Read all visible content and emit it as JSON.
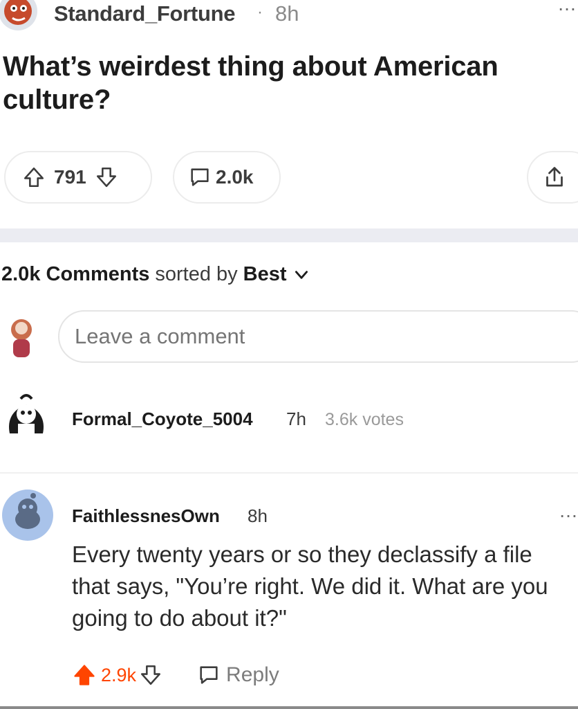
{
  "post": {
    "author": "Standard_Fortune",
    "time_separator": "·",
    "time": "8h",
    "more_icon": "…",
    "title": "What’s weirdest thing about American culture?",
    "upvotes": "791",
    "comments": "2.0k"
  },
  "comments_header": {
    "count": "2.0k Comments",
    "sorted_by": "sorted by",
    "sort": "Best"
  },
  "comment_input": {
    "placeholder": "Leave a comment"
  },
  "comments": [
    {
      "user": "Formal_Coyote_5004",
      "time": "7h",
      "votes": "3.6k votes"
    },
    {
      "user": "FaithlessnesOwn",
      "time": "8h",
      "more_icon": "…",
      "body": "Every twenty years or so they declassify a file\nthat says, \"You’re right. We did it. What are you\ngoing to do about it?\"",
      "score": "2.9k",
      "reply_label": "Reply"
    }
  ],
  "colors": {
    "upvote_active": "#ff4500",
    "muted": "#8a8a8a",
    "divider": "#ebecf2"
  }
}
